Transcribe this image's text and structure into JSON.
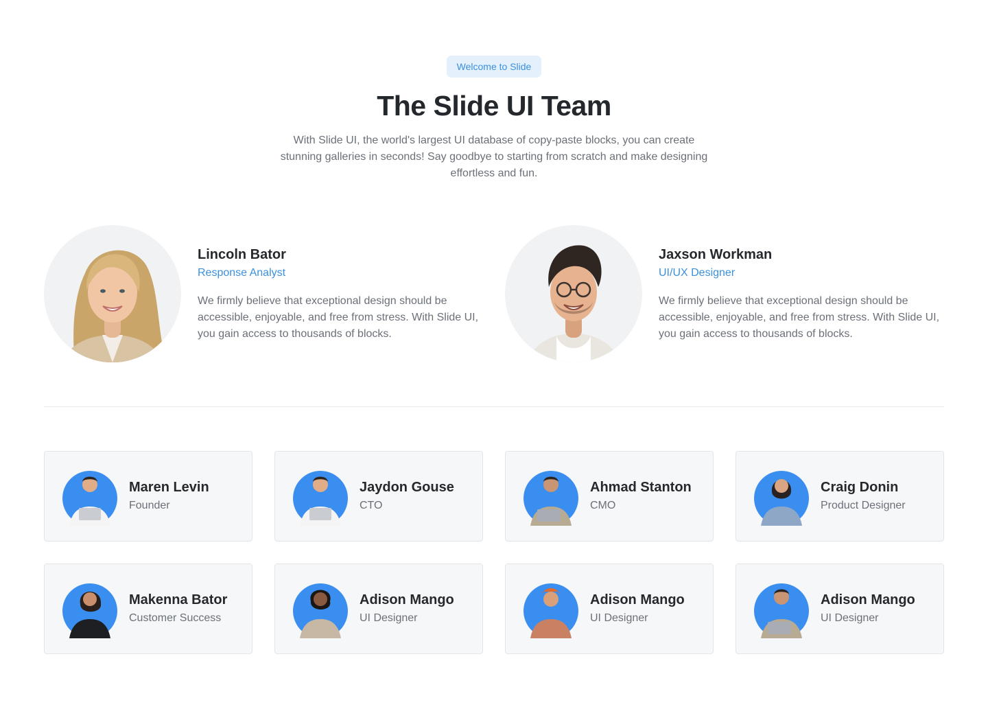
{
  "hero": {
    "badge": "Welcome to Slide",
    "title": "The Slide UI Team",
    "description": "With Slide UI, the world's largest UI database of copy-paste blocks, you can create stunning galleries in seconds! Say goodbye to starting from scratch and make designing effortless and fun."
  },
  "featured": [
    {
      "name": "Lincoln Bator",
      "role": "Response Analyst",
      "bio": "We firmly believe that exceptional design should be accessible, enjoyable, and free from stress. With Slide UI, you gain access to thousands of blocks."
    },
    {
      "name": "Jaxson Workman",
      "role": "UI/UX Designer",
      "bio": "We firmly believe that exceptional design should be accessible, enjoyable, and free from stress. With Slide UI, you gain access to thousands of blocks."
    }
  ],
  "team": [
    {
      "name": "Maren Levin",
      "role": "Founder"
    },
    {
      "name": "Jaydon Gouse",
      "role": "CTO"
    },
    {
      "name": "Ahmad Stanton",
      "role": "CMO"
    },
    {
      "name": "Craig Donin",
      "role": "Product Designer"
    },
    {
      "name": "Makenna Bator",
      "role": "Customer Success"
    },
    {
      "name": "Adison Mango",
      "role": "UI Designer"
    },
    {
      "name": "Adison Mango",
      "role": "UI Designer"
    },
    {
      "name": "Adison Mango",
      "role": "UI Designer"
    }
  ],
  "colors": {
    "accent": "#3b8fde",
    "avatar_bg": "#3a8ef0",
    "card_bg": "#f6f7f8"
  }
}
